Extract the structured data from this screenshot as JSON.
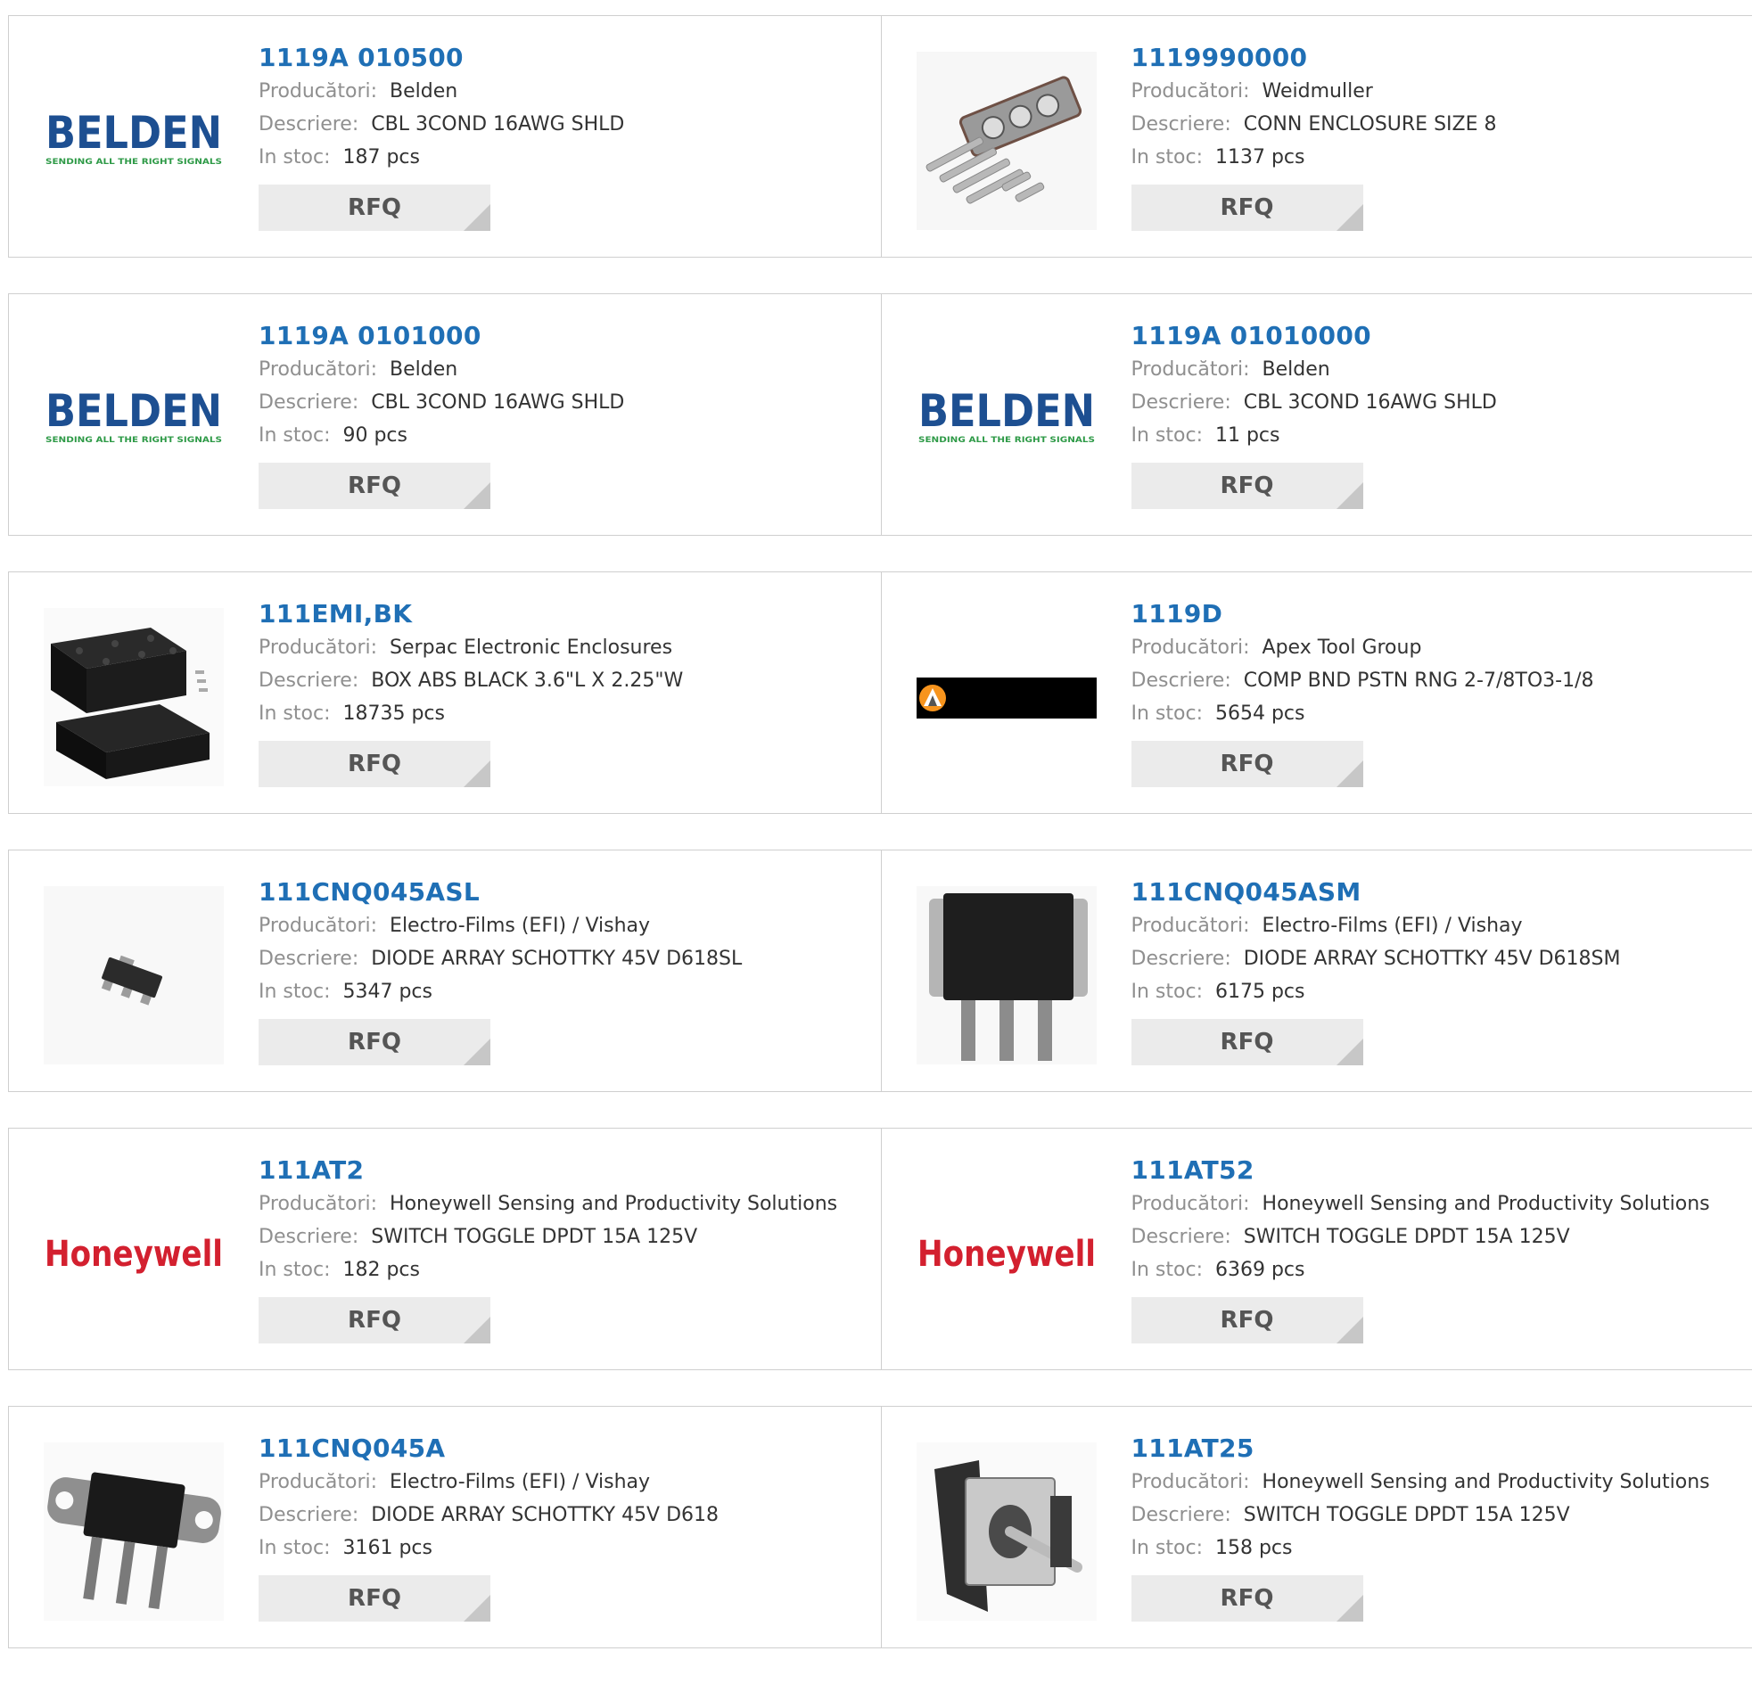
{
  "labels": {
    "manufacturer": "Producători:",
    "description": "Descriere:",
    "stock": "In stoc:",
    "rfq": "RFQ"
  },
  "colors": {
    "part_link": "#1f6fb5",
    "label": "#8f8f8f",
    "value": "#333333",
    "rfq_bg": "#ebebeb",
    "belden_blue": "#1d4f91",
    "belden_green": "#2e9a47",
    "honeywell_red": "#d3202f"
  },
  "products": [
    {
      "part": "1119A 010500",
      "manufacturer": "Belden",
      "description": "CBL 3COND 16AWG SHLD",
      "stock": "187 pcs",
      "image": "belden-logo",
      "logo_text": "BELDEN",
      "logo_tagline": "SENDING ALL THE RIGHT SIGNALS"
    },
    {
      "part": "1119990000",
      "manufacturer": "Weidmuller",
      "description": "CONN ENCLOSURE SIZE 8",
      "stock": "1137 pcs",
      "image": "enclosure-kit-photo"
    },
    {
      "part": "1119A 0101000",
      "manufacturer": "Belden",
      "description": "CBL 3COND 16AWG SHLD",
      "stock": "90 pcs",
      "image": "belden-logo",
      "logo_text": "BELDEN",
      "logo_tagline": "SENDING ALL THE RIGHT SIGNALS"
    },
    {
      "part": "1119A 01010000",
      "manufacturer": "Belden",
      "description": "CBL 3COND 16AWG SHLD",
      "stock": "11 pcs",
      "image": "belden-logo",
      "logo_text": "BELDEN",
      "logo_tagline": "SENDING ALL THE RIGHT SIGNALS"
    },
    {
      "part": "111EMI,BK",
      "manufacturer": "Serpac Electronic Enclosures",
      "description": "BOX ABS BLACK 3.6\"L X 2.25\"W",
      "stock": "18735 pcs",
      "image": "black-box-photo"
    },
    {
      "part": "1119D",
      "manufacturer": "Apex Tool Group",
      "description": "COMP BND PSTN RNG 2-7/8TO3-1/8",
      "stock": "5654 pcs",
      "image": "apex-logo"
    },
    {
      "part": "111CNQ045ASL",
      "manufacturer": "Electro-Films (EFI) / Vishay",
      "description": "DIODE ARRAY SCHOTTKY 45V D618SL",
      "stock": "5347 pcs",
      "image": "smd-diode-photo"
    },
    {
      "part": "111CNQ045ASM",
      "manufacturer": "Electro-Films (EFI) / Vishay",
      "description": "DIODE ARRAY SCHOTTKY 45V D618SM",
      "stock": "6175 pcs",
      "image": "power-diode-photo"
    },
    {
      "part": "111AT2",
      "manufacturer": "Honeywell Sensing and Productivity Solutions",
      "description": "SWITCH TOGGLE DPDT 15A 125V",
      "stock": "182 pcs",
      "image": "honeywell-logo",
      "logo_text": "Honeywell"
    },
    {
      "part": "111AT52",
      "manufacturer": "Honeywell Sensing and Productivity Solutions",
      "description": "SWITCH TOGGLE DPDT 15A 125V",
      "stock": "6369 pcs",
      "image": "honeywell-logo",
      "logo_text": "Honeywell"
    },
    {
      "part": "111CNQ045A",
      "manufacturer": "Electro-Films (EFI) / Vishay",
      "description": "DIODE ARRAY SCHOTTKY 45V D618",
      "stock": "3161 pcs",
      "image": "tab-diode-photo"
    },
    {
      "part": "111AT25",
      "manufacturer": "Honeywell Sensing and Productivity Solutions",
      "description": "SWITCH TOGGLE DPDT 15A 125V",
      "stock": "158 pcs",
      "image": "toggle-switch-photo"
    }
  ]
}
